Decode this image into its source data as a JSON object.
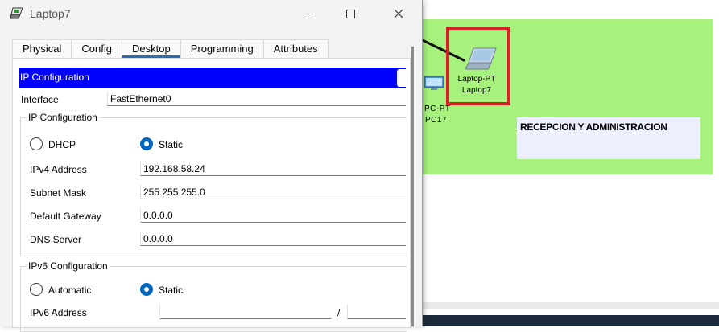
{
  "window": {
    "title": "Laptop7"
  },
  "tabs": [
    "Physical",
    "Config",
    "Desktop",
    "Programming",
    "Attributes"
  ],
  "active_tab": "Desktop",
  "panel": {
    "header": "IP Configuration",
    "interface_label": "Interface",
    "interface_value": "FastEthernet0",
    "ipv4_group": {
      "title": "IP Configuration",
      "dhcp_label": "DHCP",
      "static_label": "Static",
      "selected_mode": "Static",
      "ipv4_label": "IPv4 Address",
      "ipv4_value": "192.168.58.24",
      "mask_label": "Subnet Mask",
      "mask_value": "255.255.255.0",
      "gateway_label": "Default Gateway",
      "gateway_value": "0.0.0.0",
      "dns_label": "DNS Server",
      "dns_value": "0.0.0.0"
    },
    "ipv6_group": {
      "title": "IPv6 Configuration",
      "auto_label": "Automatic",
      "static_label": "Static",
      "selected_mode": "Static",
      "ipv6_label": "IPv6 Address",
      "ipv6_value": "",
      "prefix_separator": "/",
      "prefix_value": ""
    }
  },
  "workspace": {
    "pc_device": {
      "type": "PC-PT",
      "name": "PC17"
    },
    "laptop_device": {
      "type": "Laptop-PT",
      "name": "Laptop7"
    },
    "area_label": "RECEPCION Y ADMINISTRACION",
    "colors": {
      "zone": "#a6f27c",
      "selection": "#d81f26",
      "header": "#0000ff",
      "accent": "#0067c0"
    }
  },
  "icons": [
    "app-icon",
    "minimize-icon",
    "maximize-icon",
    "close-icon",
    "pc-icon",
    "laptop-icon"
  ]
}
